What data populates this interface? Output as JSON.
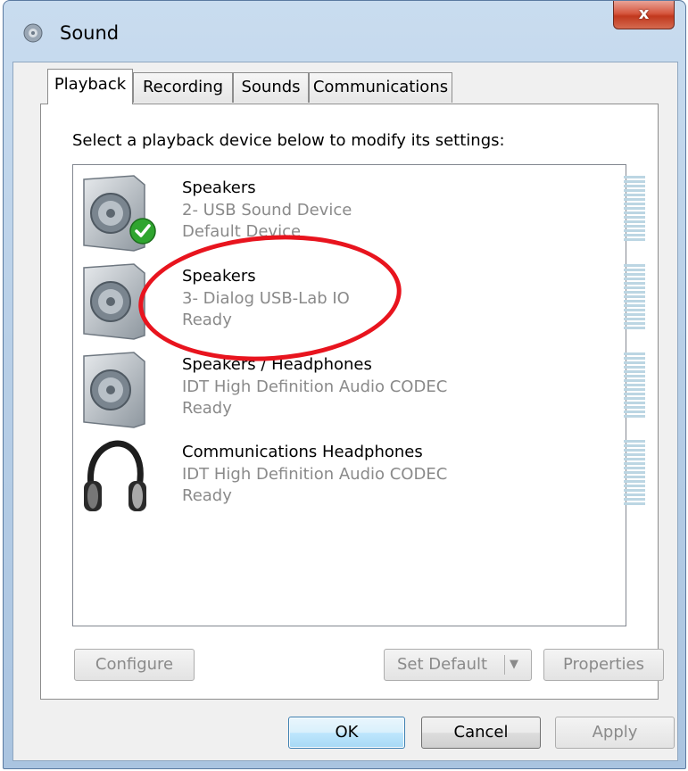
{
  "window": {
    "title": "Sound",
    "close_label": "x"
  },
  "tabs": [
    {
      "label": "Playback"
    },
    {
      "label": "Recording"
    },
    {
      "label": "Sounds"
    },
    {
      "label": "Communications"
    }
  ],
  "playback": {
    "instruction": "Select a playback device below to modify its settings:",
    "devices": [
      {
        "name": "Speakers",
        "description": "2- USB Sound Device",
        "status": "Default Device",
        "icon": "speaker-icon",
        "default_check": true
      },
      {
        "name": "Speakers",
        "description": "3- Dialog USB-Lab IO",
        "status": "Ready",
        "icon": "speaker-icon",
        "default_check": false
      },
      {
        "name": "Speakers / Headphones",
        "description": "IDT High Definition Audio CODEC",
        "status": "Ready",
        "icon": "speaker-icon",
        "default_check": false
      },
      {
        "name": "Communications Headphones",
        "description": "IDT High Definition Audio CODEC",
        "status": "Ready",
        "icon": "headphones-icon",
        "default_check": false
      }
    ],
    "buttons": {
      "configure": "Configure",
      "set_default": "Set Default",
      "properties": "Properties"
    }
  },
  "dialog_buttons": {
    "ok": "OK",
    "cancel": "Cancel",
    "apply": "Apply"
  },
  "colors": {
    "annotation": "#e8141e",
    "meter": "#bcd6e3",
    "default_check": "#2fa52f"
  }
}
